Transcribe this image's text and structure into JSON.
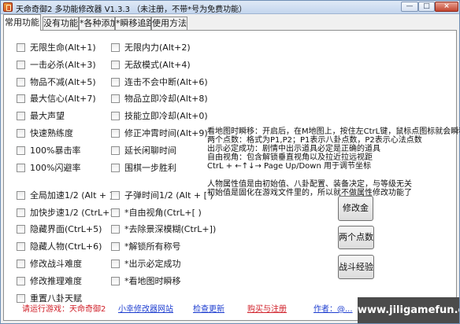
{
  "window": {
    "title": "天命奇御2 多功能修改器 V1.3.3 （未注册，不带*号为免费功能）",
    "minimize_glyph": "—",
    "maximize_glyph": "□",
    "close_glyph": "×"
  },
  "tabs": [
    {
      "label": "常用功能",
      "active": true
    },
    {
      "label": "没有功能"
    },
    {
      "label": "*各种添加"
    },
    {
      "label": "*瞬移追踪"
    },
    {
      "label": "使用方法"
    }
  ],
  "left_checkboxes": [
    {
      "label": "无限生命(Alt+1)",
      "checked": false
    },
    {
      "label": "一击必杀(Alt+3)",
      "checked": false
    },
    {
      "label": "物品不减(Alt+5)",
      "checked": false
    },
    {
      "label": "最大信心(Alt+7)",
      "checked": false
    },
    {
      "label": "最大声望",
      "checked": false
    },
    {
      "label": "快速熟练度",
      "checked": false
    },
    {
      "label": "100%暴击率",
      "checked": false
    },
    {
      "label": "100%闪避率",
      "checked": false
    },
    {
      "label": "全局加速1/2 (Alt + ] )",
      "checked": false
    },
    {
      "label": "加快步速1/2 (CtrL+1)",
      "checked": false
    },
    {
      "label": "隐藏界面(CtrL+5)",
      "checked": false
    },
    {
      "label": "隐藏人物(CtrL+6)",
      "checked": false
    },
    {
      "label": "修改战斗难度",
      "checked": false
    },
    {
      "label": "修改推理难度",
      "checked": false
    },
    {
      "label": "重置八卦天赋",
      "checked": false
    }
  ],
  "right_checkboxes": [
    {
      "label": "无限内力(Alt+2)",
      "checked": false
    },
    {
      "label": "无敌模式(Alt+4)",
      "checked": false
    },
    {
      "label": "连击不会中断(Alt+6)",
      "checked": false
    },
    {
      "label": "物品立即冷却(Alt+8)",
      "checked": false
    },
    {
      "label": "技能立即冷却(Alt+0)",
      "checked": false
    },
    {
      "label": "修正冲霄时间(Alt+9)",
      "checked": false
    },
    {
      "label": "延长闲聊时间",
      "checked": false
    },
    {
      "label": "围棋一步胜利",
      "checked": false
    },
    {
      "label": "子弹时间1/2 (Alt + [ )",
      "checked": false
    },
    {
      "label": "*自由视角(CtrL+[ )",
      "checked": false
    },
    {
      "label": "*去除景深模糊(CtrL+])",
      "checked": false
    },
    {
      "label": "*解锁所有称号",
      "checked": false
    },
    {
      "label": "*出示必定成功",
      "checked": false
    },
    {
      "label": "*看地图时瞬移",
      "checked": false
    }
  ],
  "info_lines": [
    "看地图时瞬移：开启后，在M地图上，按住左CtrL键，鼠标点图标就会瞬移",
    "两个点数：格式为P1,P2；P1表示八卦点数，P2表示心法点数",
    "出示必定成功：剧情中出示道具必定是正确的道具",
    "自由视角：包含解锁垂直视角以及拉近拉远视距",
    "CtrL + ←↑↓→ Page Up/Down 用于调节坐标",
    "",
    "人物属性值是由初始值、八卦配置、装备决定，与等级无关",
    "初始值是固化在游戏文件里的，所以就不做属性修改功能了"
  ],
  "buttons": {
    "modify_money": "修改金钱",
    "two_points": "两个点数",
    "battle_exp": "战斗经验"
  },
  "footer": {
    "game_label": "请运行游戏：天命奇御2",
    "site_link": "小幸修改器网站",
    "update_link": "检查更新",
    "buy_link": "购买与注册",
    "author_link": "作者：@..."
  },
  "watermark": "www.jiligamefun.com"
}
